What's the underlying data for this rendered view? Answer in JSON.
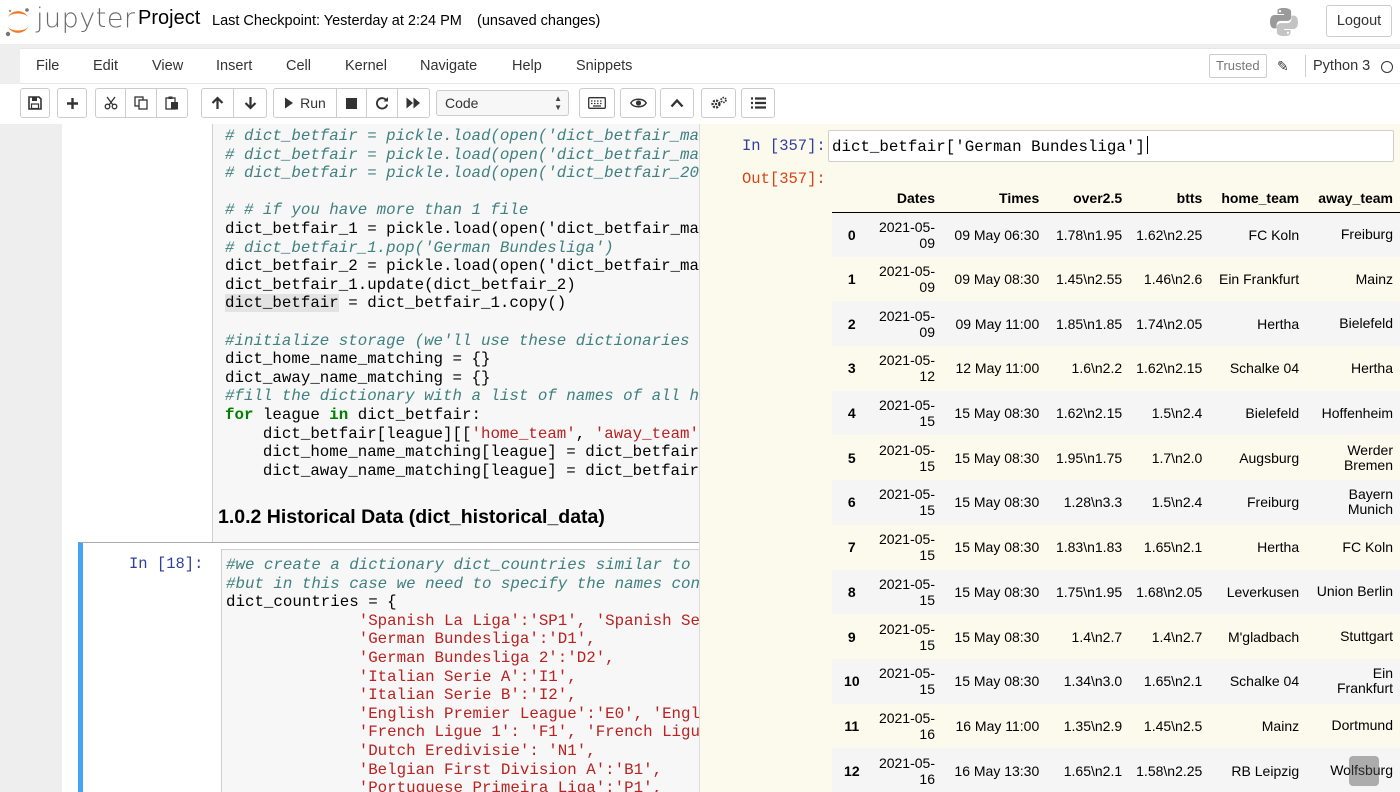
{
  "header": {
    "logo_text": "jupyter",
    "notebook_name": "Project",
    "checkpoint": "Last Checkpoint: Yesterday at 2:24 PM",
    "autosave": "(unsaved changes)",
    "logout": "Logout"
  },
  "menu": {
    "items": [
      "File",
      "Edit",
      "View",
      "Insert",
      "Cell",
      "Kernel",
      "Navigate",
      "Help",
      "Snippets"
    ],
    "trusted": "Trusted",
    "kernel": "Python 3"
  },
  "toolbar": {
    "run_label": "Run",
    "cell_type": "Code",
    "icons": [
      "save-icon",
      "plus-icon",
      "cut-icon",
      "copy-icon",
      "paste-icon",
      "arrow-up-icon",
      "arrow-down-icon",
      "run-icon",
      "stop-icon",
      "restart-icon",
      "fast-forward-icon",
      "keyboard-icon",
      "eye-icon",
      "chevron-up-icon",
      "gears-icon",
      "list-icon"
    ]
  },
  "notebook": {
    "cell1_lines": [
      "# dict_betfair = pickle.load(open('dict_betfair_mai",
      "# dict_betfair = pickle.load(open('dict_betfair_mai",
      "# dict_betfair = pickle.load(open('dict_betfair_202",
      "",
      "# # if you have more than 1 file",
      "dict_betfair_1 = pickle.load(open('dict_betfair_mai",
      "# dict_betfair_1.pop('German Bundesliga')",
      "dict_betfair_2 = pickle.load(open('dict_betfair_mai",
      "dict_betfair_1.update(dict_betfair_2)",
      "dict_betfair = dict_betfair_1.copy()",
      "",
      "#initialize storage (we'll use these dictionaries t",
      "dict_home_name_matching = {}",
      "dict_away_name_matching = {}",
      "#fill the dictionary with a list of names of all ho",
      "for league in dict_betfair:",
      "    dict_betfair[league][['home_team', 'away_team']",
      "    dict_home_name_matching[league] = dict_betfair",
      "    dict_away_name_matching[league] = dict_betfair"
    ],
    "heading": "1.0.2  Historical Data (dict_historical_data)",
    "cell2_prompt": "In [18]:",
    "cell2_lines": [
      "#we create a dictionary dict_countries similar to t",
      "#but in this case we need to specify the names cons",
      "dict_countries = {",
      "              'Spanish La Liga':'SP1', 'Spanish Seg",
      "              'German Bundesliga':'D1',",
      "              'German Bundesliga 2':'D2',",
      "              'Italian Serie A':'I1',",
      "              'Italian Serie B':'I2',",
      "              'English Premier League':'E0', 'Engli",
      "              'French Ligue 1': 'F1', 'French Ligue",
      "              'Dutch Eredivisie': 'N1',",
      "              'Belgian First Division A':'B1',",
      "              'Portuguese Primeira Liga':'P1',"
    ]
  },
  "scratchpad": {
    "in_prompt": "In [357]:",
    "input_code": "dict_betfair['German Bundesliga']",
    "out_prompt": "Out[357]:",
    "columns": [
      "",
      "Dates",
      "Times",
      "over2.5",
      "btts",
      "home_team",
      "away_team"
    ],
    "rows": [
      [
        "0",
        "2021-05-09",
        "09 May 06:30",
        "1.78\\n1.95",
        "1.62\\n2.25",
        "FC Koln",
        "Freiburg"
      ],
      [
        "1",
        "2021-05-09",
        "09 May 08:30",
        "1.45\\n2.55",
        "1.46\\n2.6",
        "Ein Frankfurt",
        "Mainz"
      ],
      [
        "2",
        "2021-05-09",
        "09 May 11:00",
        "1.85\\n1.85",
        "1.74\\n2.05",
        "Hertha",
        "Bielefeld"
      ],
      [
        "3",
        "2021-05-12",
        "12 May 11:00",
        "1.6\\n2.2",
        "1.62\\n2.15",
        "Schalke 04",
        "Hertha"
      ],
      [
        "4",
        "2021-05-15",
        "15 May 08:30",
        "1.62\\n2.15",
        "1.5\\n2.4",
        "Bielefeld",
        "Hoffenheim"
      ],
      [
        "5",
        "2021-05-15",
        "15 May 08:30",
        "1.95\\n1.75",
        "1.7\\n2.0",
        "Augsburg",
        "Werder Bremen"
      ],
      [
        "6",
        "2021-05-15",
        "15 May 08:30",
        "1.28\\n3.3",
        "1.5\\n2.4",
        "Freiburg",
        "Bayern Munich"
      ],
      [
        "7",
        "2021-05-15",
        "15 May 08:30",
        "1.83\\n1.83",
        "1.65\\n2.1",
        "Hertha",
        "FC Koln"
      ],
      [
        "8",
        "2021-05-15",
        "15 May 08:30",
        "1.75\\n1.95",
        "1.68\\n2.05",
        "Leverkusen",
        "Union Berlin"
      ],
      [
        "9",
        "2021-05-15",
        "15 May 08:30",
        "1.4\\n2.7",
        "1.4\\n2.7",
        "M'gladbach",
        "Stuttgart"
      ],
      [
        "10",
        "2021-05-15",
        "15 May 08:30",
        "1.34\\n3.0",
        "1.65\\n2.1",
        "Schalke 04",
        "Ein Frankfurt"
      ],
      [
        "11",
        "2021-05-16",
        "16 May 11:00",
        "1.35\\n2.9",
        "1.45\\n2.5",
        "Mainz",
        "Dortmund"
      ],
      [
        "12",
        "2021-05-16",
        "16 May 13:30",
        "1.65\\n2.1",
        "1.58\\n2.25",
        "RB Leipzig",
        "Wolfsburg"
      ]
    ]
  }
}
